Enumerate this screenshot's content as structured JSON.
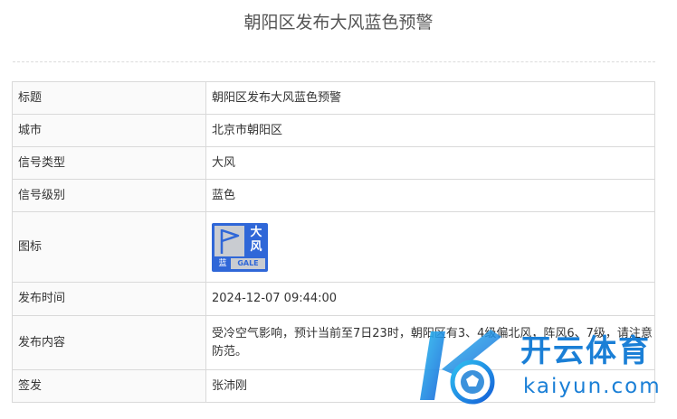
{
  "page": {
    "title": "朝阳区发布大风蓝色预警"
  },
  "rows": {
    "title": {
      "label": "标题",
      "value": "朝阳区发布大风蓝色预警"
    },
    "city": {
      "label": "城市",
      "value": "北京市朝阳区"
    },
    "signal_type": {
      "label": "信号类型",
      "value": "大风"
    },
    "signal_level": {
      "label": "信号级别",
      "value": "蓝色"
    },
    "icon": {
      "label": "图标",
      "icon_name": "gale-blue-warning-icon",
      "char1": "大",
      "char2": "风",
      "level_char": "蓝",
      "english": "GALE",
      "colors": {
        "background": "#2f67d8",
        "panel": "#c9ccd1"
      }
    },
    "publish_time": {
      "label": "发布时间",
      "value": "2024-12-07 09:44:00"
    },
    "content": {
      "label": "发布内容",
      "value": "受冷空气影响，预计当前至7日23时，朝阳区有3、4级偏北风，阵风6、7级，请注意防范。"
    },
    "signer": {
      "label": "签发",
      "value": "张沛刚"
    }
  },
  "watermark": {
    "cn_text": "开云体育",
    "en_text": "kaiyun.com",
    "color": "#1a7fd6"
  }
}
